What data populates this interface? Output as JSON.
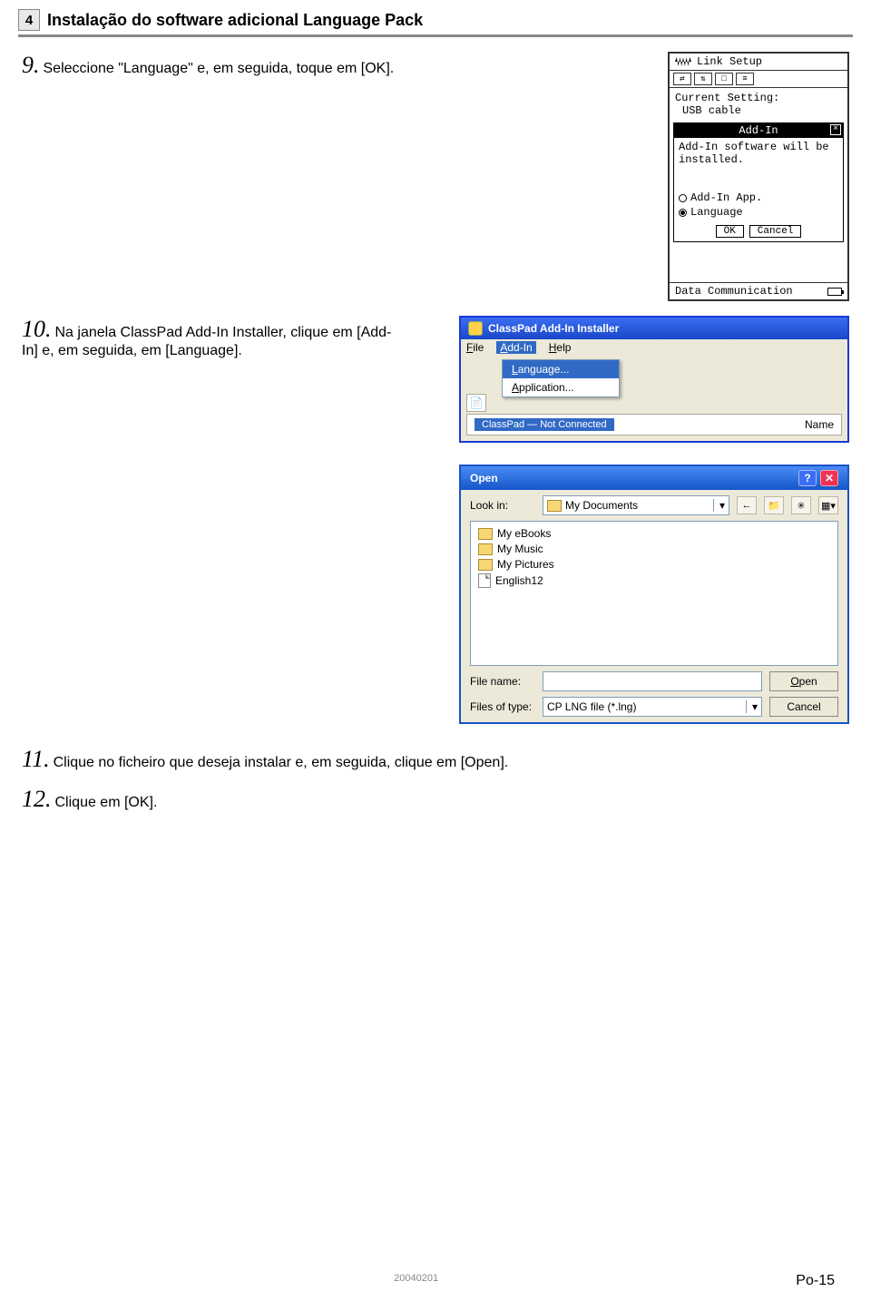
{
  "header": {
    "section_number": "4",
    "title": "Instalação do software adicional Language Pack"
  },
  "steps": {
    "s9": {
      "num": "9.",
      "text": "Seleccione \"Language\" e, em seguida, toque em [OK]."
    },
    "s10": {
      "num": "10.",
      "text": "Na janela ClassPad Add-In Installer, clique em [Add-In] e, em seguida, em [Language]."
    },
    "s11": {
      "num": "11.",
      "text": "Clique no ficheiro que deseja instalar e, em seguida, clique em [Open]."
    },
    "s12": {
      "num": "12.",
      "text": "Clique em [OK]."
    }
  },
  "device": {
    "title": "Link Setup",
    "current_label": "Current Setting:",
    "current_value": "USB cable",
    "dialog_title": "Add-In",
    "dialog_msg": "Add-In software will be installed.",
    "radio1": "Add-In App.",
    "radio2": "Language",
    "ok": "OK",
    "cancel": "Cancel",
    "footer": "Data Communication"
  },
  "installer": {
    "title": "ClassPad Add-In Installer",
    "menu": {
      "file": "File",
      "addin": "Add-In",
      "help": "Help"
    },
    "dropdown": {
      "language": "Language...",
      "application": "Application..."
    },
    "status": "ClassPad — Not Connected",
    "col": "Name"
  },
  "opendlg": {
    "title": "Open",
    "lookin": "Look in:",
    "folder": "My Documents",
    "items": [
      "My eBooks",
      "My Music",
      "My Pictures",
      "English12"
    ],
    "filename_lbl": "File name:",
    "filename_val": "",
    "filetype_lbl": "Files of type:",
    "filetype_val": "CP LNG file (*.lng)",
    "open": "Open",
    "cancel": "Cancel"
  },
  "footer": {
    "date": "20040201",
    "page": "Po-15"
  }
}
